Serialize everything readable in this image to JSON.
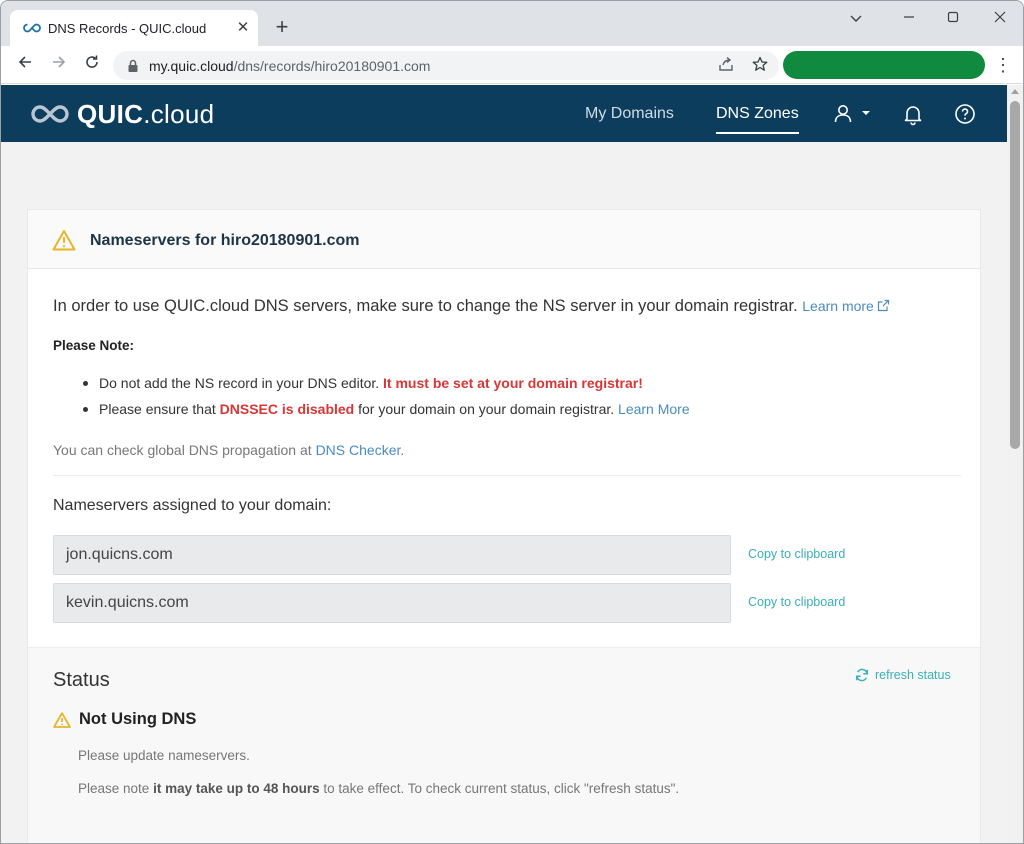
{
  "browser": {
    "tab_title": "DNS Records - QUIC.cloud",
    "url_host": "my.quic.cloud",
    "url_path": "/dns/records/hiro20180901.com",
    "colors": {
      "tab_strip": "#dfe3e7",
      "profile_pill": "#108a3e"
    }
  },
  "site_nav": {
    "logo_bold": "QUIC",
    "logo_rest": ".cloud",
    "links": [
      {
        "label": "My Domains",
        "active": false
      },
      {
        "label": "DNS Zones",
        "active": true
      }
    ],
    "icons": [
      "user-icon",
      "bell-icon",
      "help-icon"
    ],
    "colors": {
      "background": "#0c3d5c"
    }
  },
  "card": {
    "title": "Nameservers for hiro20180901.com",
    "intro_text": "In order to use QUIC.cloud DNS servers, make sure to change the NS server in your domain registrar.",
    "intro_link": "Learn more",
    "note_heading": "Please Note:",
    "bullet1_text": "Do not add the NS record in your DNS editor.",
    "bullet1_emph": "It must be set at your domain registrar!",
    "bullet2_pre": "Please ensure that",
    "bullet2_emph": "DNSSEC is disabled",
    "bullet2_post": "for your domain on your domain registrar.",
    "bullet2_link": "Learn More",
    "propagation_pre": "You can check global DNS propagation at",
    "propagation_link": "DNS Checker",
    "propagation_post": ".",
    "nameservers_heading": "Nameservers assigned to your domain:",
    "nameservers": [
      "jon.quicns.com",
      "kevin.quicns.com"
    ],
    "copy_label": "Copy to clipboard"
  },
  "status": {
    "heading": "Status",
    "refresh_label": "refresh status",
    "state": "Not Using DNS",
    "message": "Please update nameservers.",
    "note_pre": "Please note",
    "note_emph": "it may take up to 48 hours",
    "note_post": "to take effect. To check current status, click \"refresh status\"."
  },
  "colors": {
    "link": "#4a8bc0",
    "teal_link": "#3ab0b8",
    "warning": "#e8b52a",
    "danger": "#d93636"
  }
}
